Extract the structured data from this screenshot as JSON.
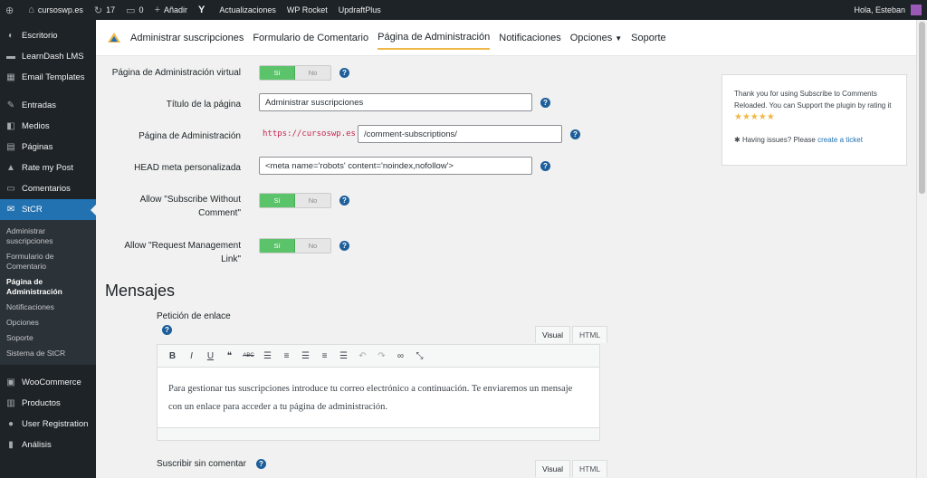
{
  "adminbar": {
    "site": "cursoswp.es",
    "updates": "17",
    "comments": "0",
    "new": "Añadir",
    "items": [
      "Actualizaciones",
      "WP Rocket",
      "UpdraftPlus"
    ],
    "greeting": "Hola, Esteban"
  },
  "sidebar": {
    "items_top": [
      {
        "label": "Escritorio",
        "icon": "dashboard-icon"
      },
      {
        "label": "LearnDash LMS",
        "icon": "learndash-icon"
      },
      {
        "label": "Email Templates",
        "icon": "email-icon"
      }
    ],
    "items_mid": [
      {
        "label": "Entradas",
        "icon": "pin-icon"
      },
      {
        "label": "Medios",
        "icon": "media-icon"
      },
      {
        "label": "Páginas",
        "icon": "pages-icon"
      },
      {
        "label": "Rate my Post",
        "icon": "rate-icon"
      },
      {
        "label": "Comentarios",
        "icon": "comments-icon"
      },
      {
        "label": "StCR",
        "icon": "stcr-icon"
      }
    ],
    "submenu": [
      "Administrar suscripciones",
      "Formulario de Comentario",
      "Página de Administración",
      "Notificaciones",
      "Opciones",
      "Soporte",
      "Sistema de StCR"
    ],
    "items_bottom": [
      {
        "label": "WooCommerce",
        "icon": "woo-icon"
      },
      {
        "label": "Productos",
        "icon": "products-icon"
      },
      {
        "label": "User Registration",
        "icon": "user-icon"
      },
      {
        "label": "Análisis",
        "icon": "analytics-icon"
      }
    ]
  },
  "tabs": [
    "Administrar suscripciones",
    "Formulario de Comentario",
    "Página de Administración",
    "Notificaciones",
    "Opciones",
    "Soporte"
  ],
  "form": {
    "virtual_label": "Página de Administración virtual",
    "title_label": "Título de la página",
    "title_value": "Administrar suscripciones",
    "admin_label": "Página de Administración",
    "admin_prefix": "https://cursoswp.es",
    "admin_value": "/comment-subscriptions/",
    "head_label": "HEAD meta personalizada",
    "head_value": "<meta name='robots' content='noindex,nofollow'>",
    "allow_subscribe_label": "Allow \"Subscribe Without Comment\"",
    "allow_request_label": "Allow \"Request Management Link\"",
    "toggle_on": "Sí",
    "toggle_off": "No",
    "help": "?"
  },
  "messages": {
    "title": "Mensajes",
    "request_label": "Petición de enlace",
    "editor_tab_visual": "Visual",
    "editor_tab_html": "HTML",
    "request_body": "Para gestionar tus suscripciones introduce tu correo electrónico a continuación. Te enviaremos un mensaje con un enlace para acceder a tu página de administración.",
    "subscribe_label": "Suscribir sin comentar"
  },
  "infobox": {
    "text": "Thank you for using Subscribe to Comments Reloaded. You can Support the plugin by rating it",
    "stars": "★★★★★",
    "issues": "Having issues? Please",
    "link": "create a ticket"
  }
}
